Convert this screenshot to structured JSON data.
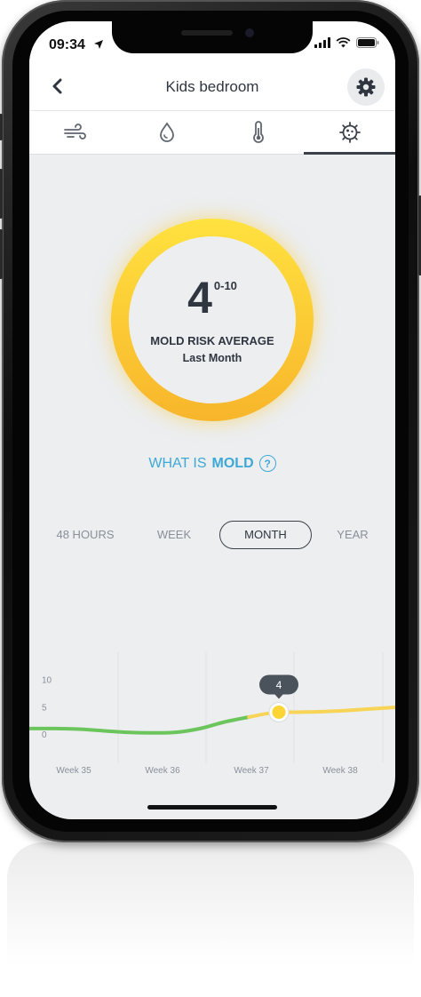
{
  "status": {
    "time": "09:34"
  },
  "header": {
    "title": "Kids bedroom"
  },
  "tabs": [
    {
      "id": "air",
      "icon": "wind-icon"
    },
    {
      "id": "humidity",
      "icon": "droplet-icon"
    },
    {
      "id": "temperature",
      "icon": "thermometer-icon"
    },
    {
      "id": "mold",
      "icon": "mold-icon",
      "active": true
    }
  ],
  "gauge": {
    "value": "4",
    "range": "0-10",
    "label": "MOLD RISK AVERAGE",
    "period": "Last Month",
    "color_top": "#ffe23f",
    "color_bottom": "#f8b52b"
  },
  "whatis": {
    "prefix": "WHAT IS",
    "strong": "MOLD",
    "help_icon": "?"
  },
  "periods": [
    {
      "label": "48 HOURS"
    },
    {
      "label": "WEEK"
    },
    {
      "label": "MONTH",
      "active": true
    },
    {
      "label": "YEAR"
    }
  ],
  "chart_data": {
    "type": "line",
    "x": [
      "Week 35",
      "Week 36",
      "Week 37",
      "Week 38"
    ],
    "y_ticks": [
      "10",
      "5",
      "0"
    ],
    "ylim": [
      0,
      10
    ],
    "selected": {
      "label": "4",
      "value": 4
    },
    "colors": {
      "low": "#6cc55c",
      "medium": "#f7d456",
      "marker": "#fcd433"
    },
    "series": [
      {
        "values": [
          1.0,
          1.0,
          0.9,
          0.6,
          0.3,
          0.2,
          0.3,
          1.0,
          2.2,
          3.1,
          3.9,
          4.0,
          4.1,
          4.3,
          4.6,
          4.9
        ]
      }
    ]
  }
}
